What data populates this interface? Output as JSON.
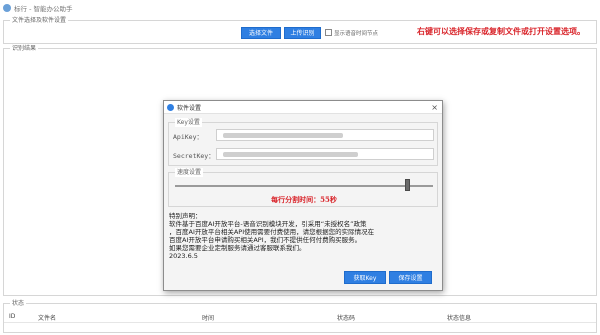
{
  "app": {
    "title": "标行 - 智能办公助手"
  },
  "file_group": {
    "legend": "文件选择及软件设置",
    "select_file_label": "选择文件",
    "upload_label": "上传识别",
    "checkbox_label": "显示语音时间节点",
    "hint": "右键可以选择保存或复制文件或打开设置选项。"
  },
  "result_group": {
    "legend": "识别结果"
  },
  "status_group": {
    "legend": "状态",
    "columns": [
      "ID",
      "文件名",
      "时间",
      "状态码",
      "状态信息"
    ]
  },
  "dialog": {
    "title": "软件设置",
    "key_group": {
      "legend": "Key设置",
      "api_key_label": "ApiKey：",
      "secret_key_label": "SecretKey："
    },
    "speed_group": {
      "legend": "速度设置",
      "slider_value_fraction": 0.9,
      "speed_text": "每行分割时间：55秒"
    },
    "notice": [
      "特别声明：",
      "软件基于百度AI开放平台-语音识别模块开发，引采用“未授权名”政策",
      "，百度AI开放平台相关API使用需要付费使用，请您根据您的实际情况在",
      "百度AI开放平台申请购买相关API，我们不提供任何付费购买服务。",
      "如果您需要企业定制服务请通过客服联系我们。",
      "2023.6.5"
    ],
    "get_key_label": "获取Key",
    "save_label": "保存设置"
  },
  "colors": {
    "accent": "#2f7fe2",
    "hint_red": "#d9252b"
  }
}
